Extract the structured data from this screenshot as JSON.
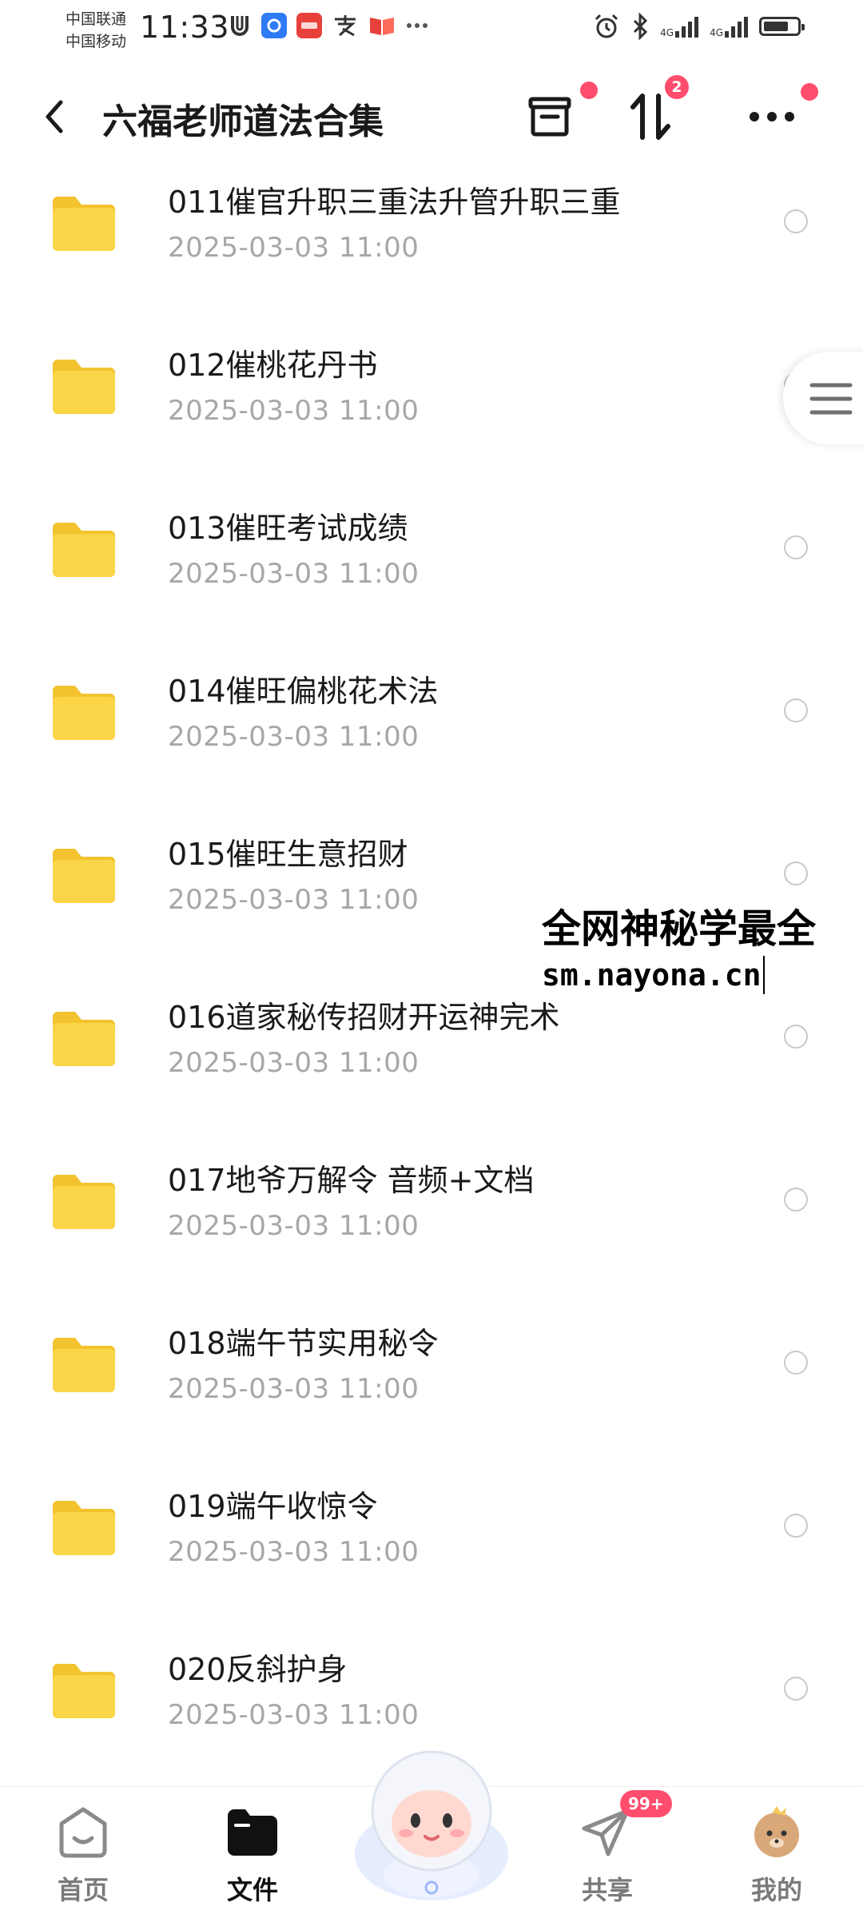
{
  "status_bar": {
    "carrier1": "中国联通",
    "carrier2": "中国移动",
    "time": "11:33",
    "net1": "4G",
    "net2": "4G"
  },
  "header": {
    "title": "六福老师道法合集",
    "sort_badge": "2"
  },
  "files": [
    {
      "name": "011催官升职三重法升管升职三重",
      "date": "2025-03-03  11:00"
    },
    {
      "name": "012催桃花丹书",
      "date": "2025-03-03  11:00"
    },
    {
      "name": "013催旺考试成绩",
      "date": "2025-03-03  11:00"
    },
    {
      "name": "014催旺偏桃花术法",
      "date": "2025-03-03  11:00"
    },
    {
      "name": "015催旺生意招财",
      "date": "2025-03-03  11:00"
    },
    {
      "name": "016道家秘传招财开运神完术",
      "date": "2025-03-03  11:00"
    },
    {
      "name": "017地爷万解令 音频+文档",
      "date": "2025-03-03  11:00"
    },
    {
      "name": "018端午节实用秘令",
      "date": "2025-03-03  11:00"
    },
    {
      "name": "019端午收惊令",
      "date": "2025-03-03  11:00"
    },
    {
      "name": "020反斜护身",
      "date": "2025-03-03  11:00"
    }
  ],
  "watermark": {
    "line1": "全网神秘学最全",
    "line2": "sm.nayona.cn"
  },
  "bottom_nav": {
    "items": [
      {
        "label": "首页",
        "icon": "home-icon",
        "active": false
      },
      {
        "label": "文件",
        "icon": "folder-icon",
        "active": true
      },
      {
        "label": "共享",
        "icon": "paper-plane-icon",
        "active": false,
        "badge": "99+"
      },
      {
        "label": "我的",
        "icon": "avatar-icon",
        "active": false
      }
    ]
  },
  "colors": {
    "folder": "#fbd548",
    "folder_dark": "#f2c32e",
    "badge_red": "#ff4d6d",
    "date_gray": "#a7a7a7"
  }
}
